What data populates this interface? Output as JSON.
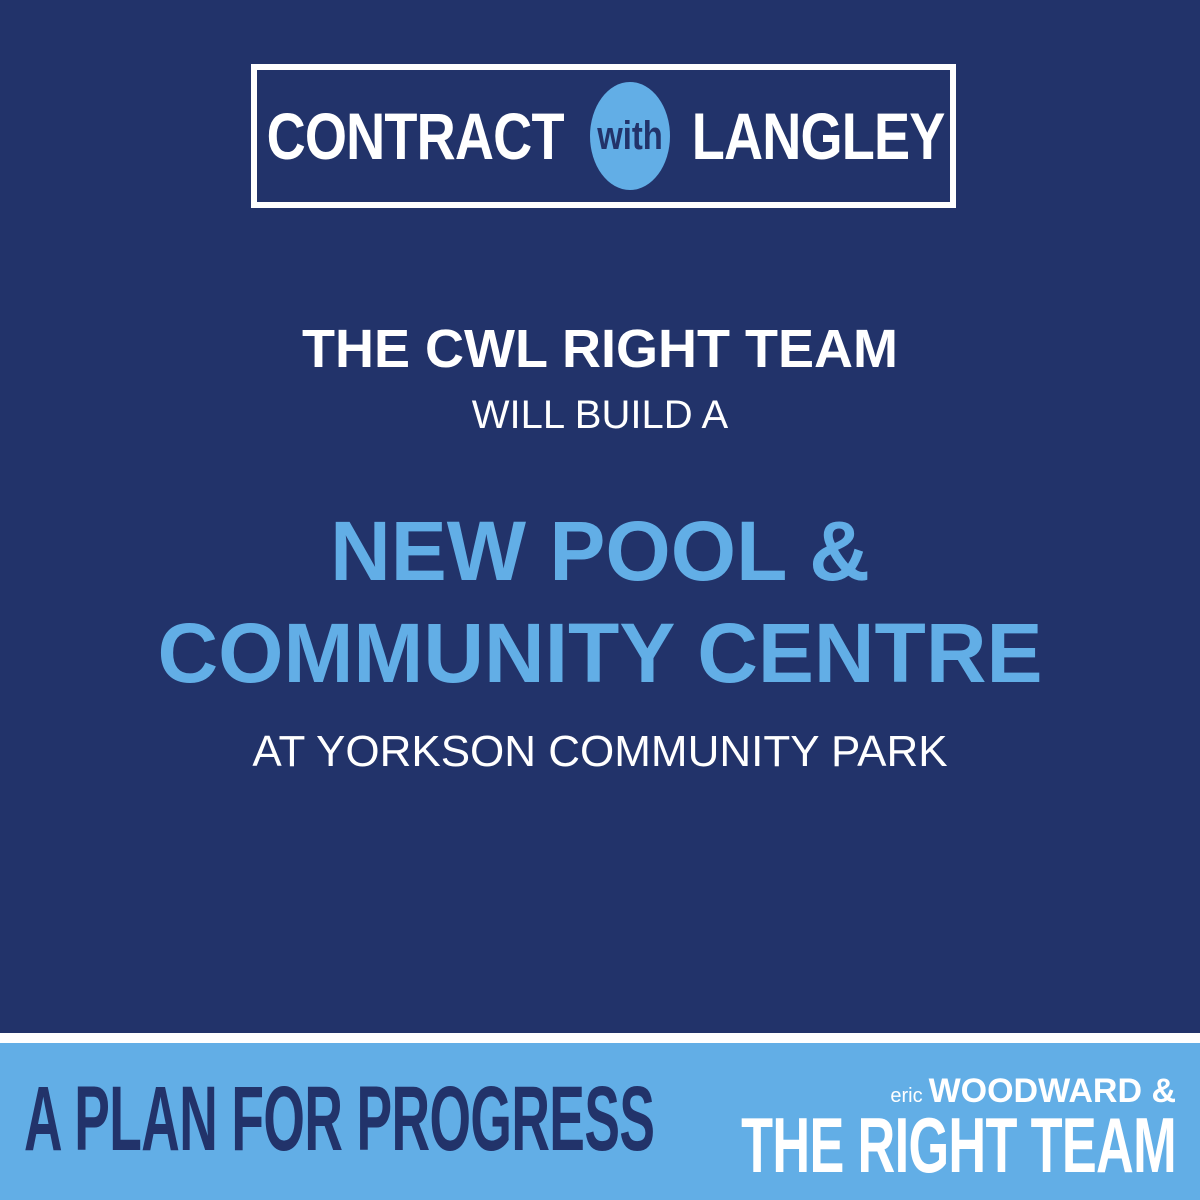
{
  "logo": {
    "word_left": "CONTRACT",
    "word_middle": "with",
    "word_right": "LANGLEY"
  },
  "headline": {
    "line1": "THE CWL RIGHT TEAM",
    "line2": "WILL BUILD A",
    "highlight_line1": "NEW POOL &",
    "highlight_line2": "COMMUNITY CENTRE",
    "line5": "AT YORKSON COMMUNITY PARK"
  },
  "footer": {
    "tagline": "A PLAN FOR PROGRESS",
    "brand_first_name": "eric",
    "brand_surname": "WOODWARD &",
    "brand_team": "THE RIGHT TEAM"
  },
  "colors": {
    "navy": "#22336a",
    "light_blue": "#62aee6",
    "white": "#ffffff"
  }
}
